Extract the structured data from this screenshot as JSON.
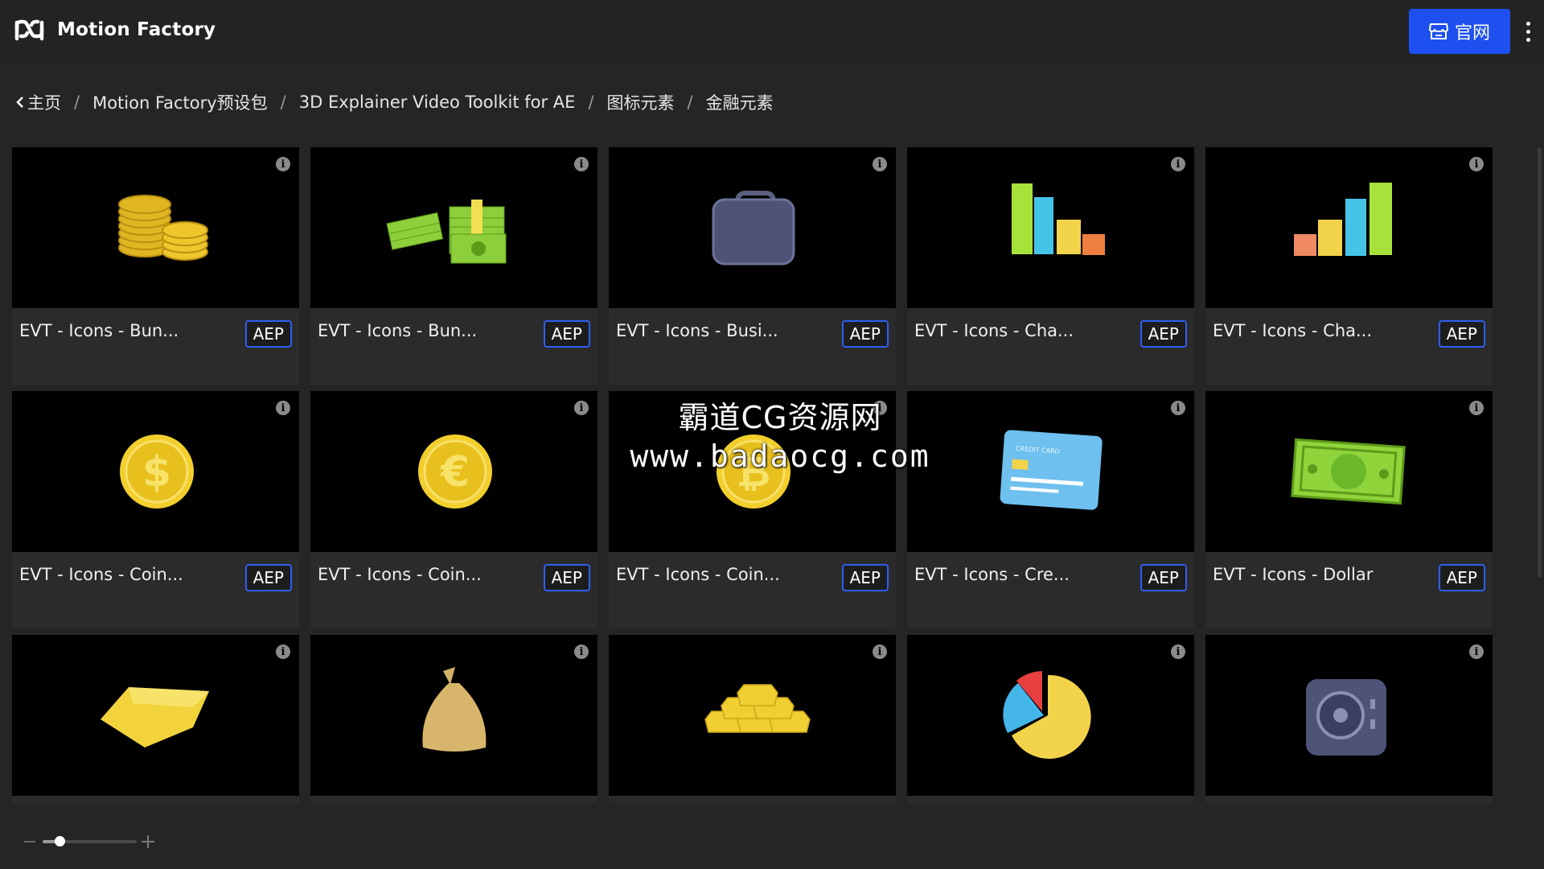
{
  "app": {
    "title": "Motion Factory",
    "logo_icon": "infinity-m-logo-icon"
  },
  "header": {
    "site_button_label": "官网",
    "site_button_icon": "store-icon",
    "accent": "#1e50f0"
  },
  "breadcrumb": [
    "主页",
    "Motion Factory预设包",
    "3D Explainer Video Toolkit for AE",
    "图标元素",
    "金融元素"
  ],
  "cards": [
    {
      "title": "EVT - Icons - Bun...",
      "badge": "AEP",
      "art": "coin-stacks"
    },
    {
      "title": "EVT - Icons - Bun...",
      "badge": "AEP",
      "art": "cash-stacks"
    },
    {
      "title": "EVT - Icons - Busi...",
      "badge": "AEP",
      "art": "briefcase"
    },
    {
      "title": "EVT - Icons - Cha...",
      "badge": "AEP",
      "art": "bar-chart-down"
    },
    {
      "title": "EVT - Icons - Cha...",
      "badge": "AEP",
      "art": "bar-chart-up"
    },
    {
      "title": "EVT - Icons - Coin...",
      "badge": "AEP",
      "art": "coin-dollar",
      "symbol": "$"
    },
    {
      "title": "EVT - Icons - Coin...",
      "badge": "AEP",
      "art": "coin-euro",
      "symbol": "€"
    },
    {
      "title": "EVT - Icons - Coin...",
      "badge": "AEP",
      "art": "coin-bitcoin",
      "symbol": "₿"
    },
    {
      "title": "EVT - Icons - Cre...",
      "badge": "AEP",
      "art": "credit-card",
      "card_text": "CREDIT CARD"
    },
    {
      "title": "EVT - Icons - Dollar",
      "badge": "AEP",
      "art": "dollar-bill",
      "symbol": "$"
    },
    {
      "title": "",
      "badge": "",
      "art": "gold-bar"
    },
    {
      "title": "",
      "badge": "",
      "art": "money-bag"
    },
    {
      "title": "",
      "badge": "",
      "art": "gold-bars-pile"
    },
    {
      "title": "",
      "badge": "",
      "art": "pie-chart"
    },
    {
      "title": "",
      "badge": "",
      "art": "safe"
    }
  ],
  "watermark": {
    "line1": "霸道CG资源网",
    "line2": "www.badaocg.com"
  },
  "zoom": {
    "level": 0.18
  }
}
